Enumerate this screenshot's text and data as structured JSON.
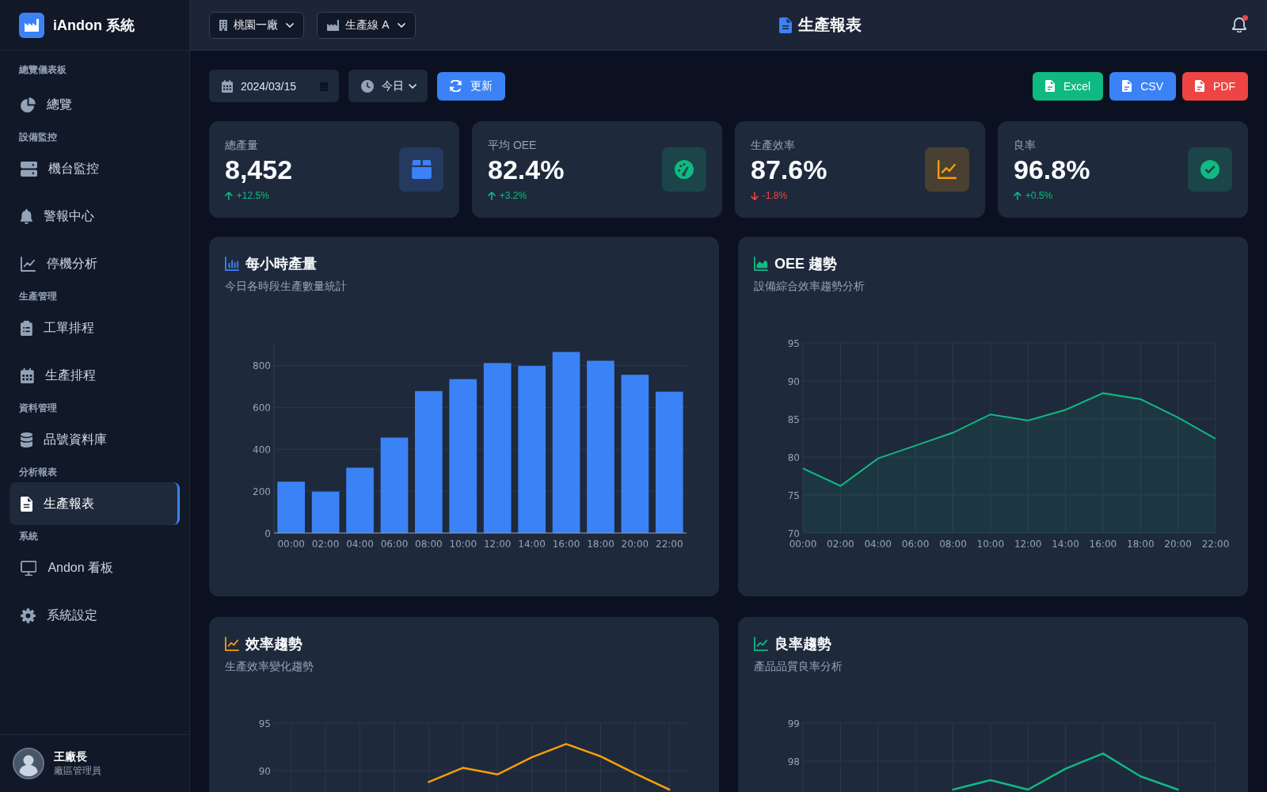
{
  "sidebar": {
    "brand": "iAndon 系統",
    "sections": [
      {
        "title": "總覽儀表板",
        "items": [
          {
            "label": "總覽",
            "selected": false
          }
        ]
      },
      {
        "title": "設備監控",
        "items": [
          {
            "label": "機台監控",
            "selected": false
          },
          {
            "label": "警報中心",
            "selected": false
          },
          {
            "label": "停機分析",
            "selected": false
          }
        ]
      },
      {
        "title": "生產管理",
        "items": [
          {
            "label": "工單排程",
            "selected": false
          },
          {
            "label": "生產排程",
            "selected": false
          }
        ]
      },
      {
        "title": "資料管理",
        "items": [
          {
            "label": "品號資料庫",
            "selected": false
          }
        ]
      },
      {
        "title": "分析報表",
        "items": [
          {
            "label": "生產報表",
            "selected": true
          }
        ]
      },
      {
        "title": "系統",
        "items": [
          {
            "label": "Andon 看板",
            "selected": false
          },
          {
            "label": "系統設定",
            "selected": false
          }
        ]
      }
    ],
    "user": {
      "name": "王廠長",
      "role": "廠區管理員"
    }
  },
  "topbar": {
    "selects": [
      {
        "value": "桃園一廠"
      },
      {
        "value": "生產線 A"
      }
    ],
    "title": "生產報表",
    "notifications": {
      "unread": true
    }
  },
  "toolbar": {
    "date": {
      "value": "2024/03/15"
    },
    "range": {
      "value": "今日"
    },
    "refresh": {
      "label": "更新"
    },
    "exports": [
      {
        "label": "Excel",
        "color": "#10b981"
      },
      {
        "label": "CSV",
        "color": "#3b82f6"
      },
      {
        "label": "PDF",
        "color": "#ef4444"
      }
    ]
  },
  "kpis": [
    {
      "label": "總產量",
      "value": "8,452",
      "change": "+12.5%",
      "rising": true,
      "color": "#3b82f6"
    },
    {
      "label": "平均 OEE",
      "value": "82.4%",
      "change": "+3.2%",
      "rising": true,
      "color": "#10b981"
    },
    {
      "label": "生產效率",
      "value": "87.6%",
      "change": "-1.8%",
      "rising": false,
      "color": "#f59e0b"
    },
    {
      "label": "良率",
      "value": "96.8%",
      "change": "+0.5%",
      "rising": true,
      "color": "#10b981"
    }
  ],
  "charts": [
    {
      "title": "每小時產量",
      "subtitle": "今日各時段生產數量統計",
      "chart_data": {
        "type": "bar",
        "grid": true,
        "categories": [
          "00:00",
          "02:00",
          "04:00",
          "06:00",
          "08:00",
          "10:00",
          "12:00",
          "14:00",
          "16:00",
          "18:00",
          "20:00",
          "22:00"
        ],
        "series": [
          {
            "color": "#3b82f6",
            "values": [
              245,
              198,
              312,
              456,
              678,
              735,
              812,
              798,
              865,
              823,
              756,
              675
            ]
          }
        ],
        "ylim": [
          0,
          908
        ],
        "yticks": [
          0,
          200,
          400,
          600,
          800
        ]
      }
    },
    {
      "title": "OEE 趨勢",
      "subtitle": "設備綜合效率趨勢分析",
      "chart_data": {
        "type": "area",
        "grid": true,
        "categories": [
          "00:00",
          "02:00",
          "04:00",
          "06:00",
          "08:00",
          "10:00",
          "12:00",
          "14:00",
          "16:00",
          "18:00",
          "20:00",
          "22:00"
        ],
        "series": [
          {
            "color": "#10b981",
            "values": [
              78.5,
              76.2,
              79.8,
              81.5,
              83.2,
              85.6,
              84.8,
              86.2,
              88.4,
              87.6,
              85.2,
              82.4
            ]
          }
        ],
        "ylim": [
          70,
          95
        ],
        "yticks": [
          70,
          75,
          80,
          85,
          90,
          95
        ]
      }
    },
    {
      "title": "效率趨勢",
      "subtitle": "生產效率變化趨勢",
      "chart_data": {
        "type": "line",
        "grid": true,
        "series": [
          {
            "color": "#f59e0b",
            "values": [
              null,
              null,
              null,
              null,
              88.8,
              90.3,
              89.6,
              91.4,
              92.8,
              91.5,
              89.7,
              88.0
            ]
          }
        ],
        "ylim": [
          75,
          95
        ],
        "yticks": [
          90,
          95
        ]
      }
    },
    {
      "title": "良率趨勢",
      "subtitle": "產品品質良率分析",
      "chart_data": {
        "type": "line",
        "grid": true,
        "series": [
          {
            "color": "#10b981",
            "values": [
              null,
              null,
              null,
              null,
              97.25,
              97.5,
              97.25,
              97.8,
              98.2,
              97.6,
              97.25,
              null
            ]
          }
        ],
        "ylim": [
          94,
          99
        ],
        "yticks": [
          98,
          99
        ]
      }
    }
  ]
}
